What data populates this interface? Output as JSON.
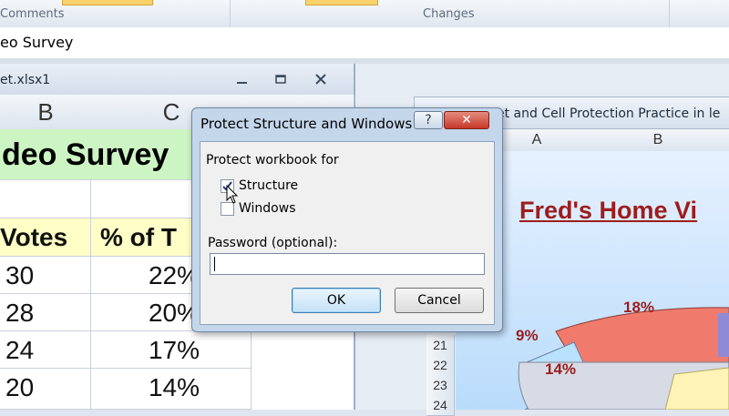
{
  "ribbon": {
    "group_left": "Comments",
    "group_right": "Changes"
  },
  "formula_bar": {
    "text": "eo Survey"
  },
  "left_workbook": {
    "title": "et.xlsx1",
    "columns": [
      "B",
      "C"
    ],
    "banner": "deo Survey",
    "header_row": [
      "Votes",
      "% of T"
    ],
    "rows": [
      [
        "30",
        "22%"
      ],
      [
        "28",
        "20%"
      ],
      [
        "24",
        "17%"
      ],
      [
        "20",
        "14%"
      ]
    ]
  },
  "right_workbook": {
    "title": "et and Cell Protection Practice in le",
    "columns": [
      "A",
      "B"
    ],
    "row_numbers": [
      "21",
      "22",
      "23",
      "24"
    ],
    "chart": {
      "title": "Fred's Home Vi",
      "labels": [
        "18%",
        "9%",
        "14%"
      ]
    }
  },
  "dialog": {
    "title": "Protect Structure and Windows",
    "help_label": "?",
    "close_label": "✕",
    "section_label": "Protect workbook for",
    "structure_label": "Structure",
    "structure_checked": true,
    "windows_label": "Windows",
    "windows_checked": false,
    "password_label": "Password (optional):",
    "ok_label": "OK",
    "cancel_label": "Cancel"
  },
  "icons": {
    "minimize": "minimize-icon",
    "restore": "restore-icon",
    "close": "close-icon",
    "checkmark": "checkmark-icon",
    "cursor": "mouse-pointer-icon"
  }
}
